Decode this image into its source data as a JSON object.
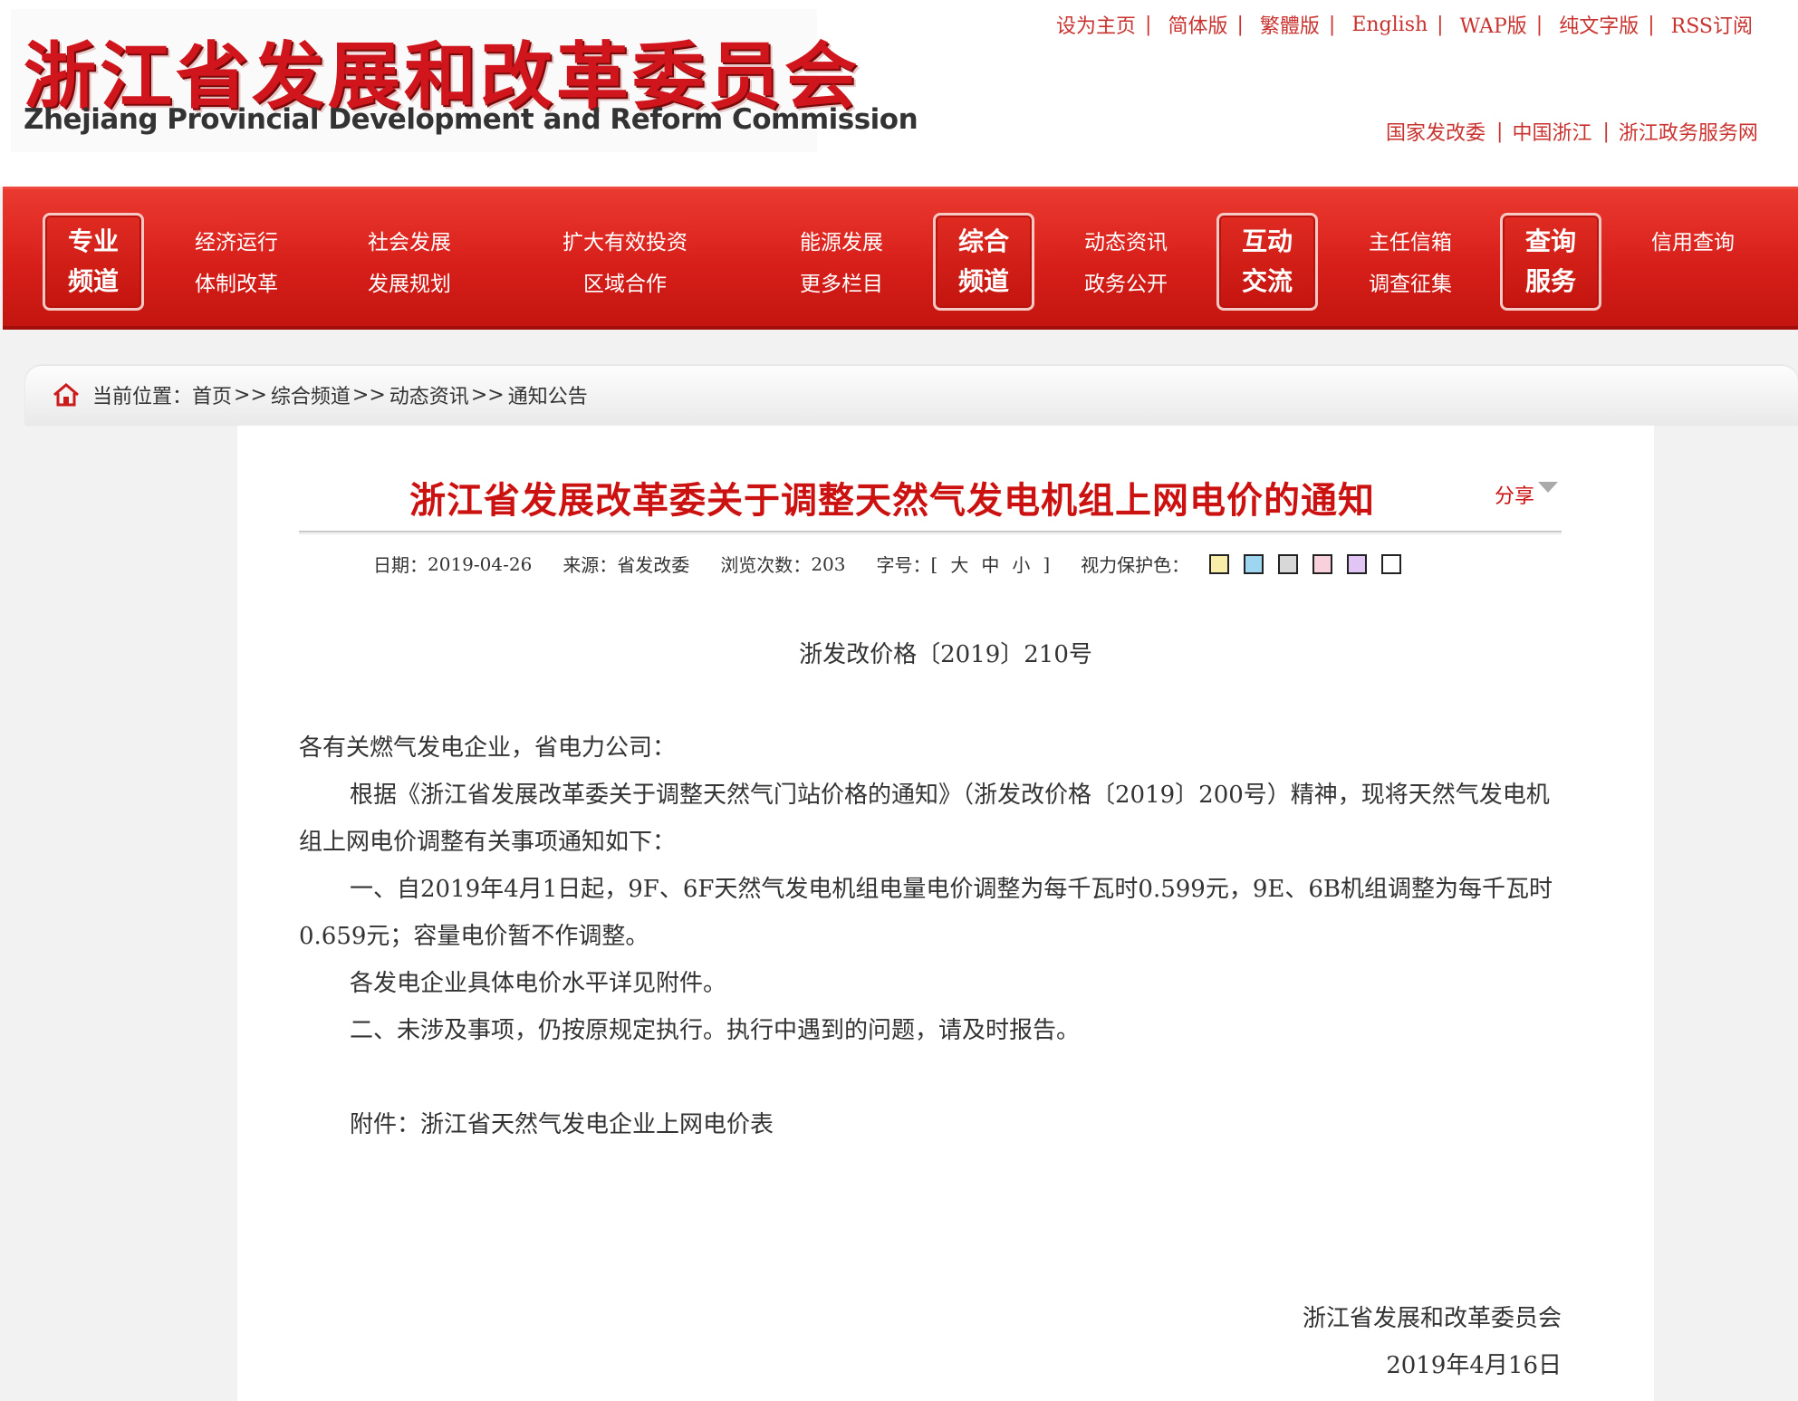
{
  "header": {
    "logo_cn": "浙江省发展和改革委员会",
    "logo_en": "Zhejiang Provincial Development and Reform Commission",
    "top_links": [
      "设为主页",
      "简体版",
      "繁體版",
      "English",
      "WAP版",
      "纯文字版",
      "RSS订阅"
    ],
    "sub_links": [
      "国家发改委",
      "中国浙江",
      "浙江政务服务网"
    ]
  },
  "nav": {
    "groups": [
      {
        "box": [
          "专业",
          "频道"
        ],
        "cols": [
          [
            "经济运行",
            "体制改革"
          ],
          [
            "社会发展",
            "发展规划"
          ],
          [
            "扩大有效投资",
            "区域合作"
          ],
          [
            "能源发展",
            "更多栏目"
          ]
        ]
      },
      {
        "box": [
          "综合",
          "频道"
        ],
        "cols": [
          [
            "动态资讯",
            "政务公开"
          ]
        ]
      },
      {
        "box": [
          "互动",
          "交流"
        ],
        "cols": [
          [
            "主任信箱",
            "调查征集"
          ]
        ]
      },
      {
        "box": [
          "查询",
          "服务"
        ],
        "cols": [
          [
            "信用查询",
            ""
          ]
        ]
      }
    ]
  },
  "breadcrumb": {
    "label": "当前位置：",
    "items": [
      "首页",
      "综合频道",
      "动态资讯",
      "通知公告"
    ],
    "separator": ">>"
  },
  "article": {
    "title": "浙江省发展改革委关于调整天然气发电机组上网电价的通知",
    "share_label": "分享",
    "meta": {
      "date_label": "日期：",
      "date": "2019-04-26",
      "source_label": "来源：",
      "source": "省发改委",
      "views_label": "浏览次数：",
      "views": "203",
      "font_label": "字号：",
      "bracket_open": "[",
      "bracket_close": "]",
      "font_sizes": [
        "大",
        "中",
        "小"
      ],
      "eye_label": "视力保护色：",
      "eye_colors": [
        "#f8eeaa",
        "#9ed6f2",
        "#d8d8d8",
        "#f9d1dd",
        "#e1c5f5",
        "#ffffff"
      ]
    },
    "doc_no": "浙发改价格〔2019〕210号",
    "salutation": "各有关燃气发电企业，省电力公司：",
    "paragraphs": [
      "根据《浙江省发展改革委关于调整天然气门站价格的通知》（浙发改价格〔2019〕200号）精神，现将天然气发电机组上网电价调整有关事项通知如下：",
      "一、自2019年4月1日起，9F、6F天然气发电机组电量电价调整为每千瓦时0.599元，9E、6B机组调整为每千瓦时0.659元；容量电价暂不作调整。",
      "各发电企业具体电价水平详见附件。",
      "二、未涉及事项，仍按原规定执行。执行中遇到的问题，请及时报告。"
    ],
    "attachment": "附件：浙江省天然气发电企业上网电价表",
    "signer": "浙江省发展和改革委员会",
    "sign_date": "2019年4月16日"
  }
}
